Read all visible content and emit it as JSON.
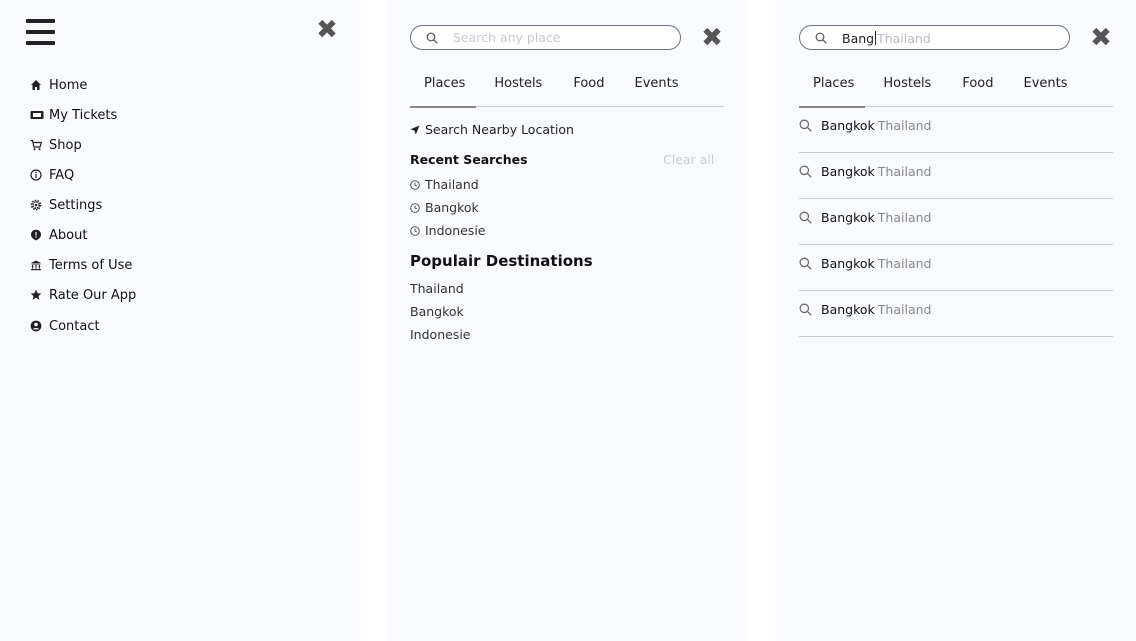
{
  "menu": {
    "items": [
      {
        "label": "Home",
        "icon": "home-icon"
      },
      {
        "label": "My Tickets",
        "icon": "ticket-icon"
      },
      {
        "label": "Shop",
        "icon": "cart-icon"
      },
      {
        "label": "FAQ",
        "icon": "info-icon"
      },
      {
        "label": "Settings",
        "icon": "gear-icon"
      },
      {
        "label": "About",
        "icon": "about-icon"
      },
      {
        "label": "Terms of Use",
        "icon": "terms-icon"
      },
      {
        "label": "Rate Our App",
        "icon": "star-icon"
      },
      {
        "label": "Contact",
        "icon": "user-icon"
      }
    ]
  },
  "search_panel": {
    "placeholder": "Search any place",
    "tabs": [
      "Places",
      "Hostels",
      "Food",
      "Events"
    ],
    "active_tab": "Places",
    "nearby_label": "Search Nearby Location",
    "recent_title": "Recent Searches",
    "clear_all": "Clear all",
    "recent": [
      "Thailand",
      "Bangkok",
      "Indonesie"
    ],
    "popular_title": "Populair Destinations",
    "popular": [
      "Thailand",
      "Bangkok",
      "Indonesie"
    ]
  },
  "results_panel": {
    "typed": "Bang",
    "suggestion": "Thailand",
    "tabs": [
      "Places",
      "Hostels",
      "Food",
      "Events"
    ],
    "active_tab": "Places",
    "results": [
      {
        "city": "Bangkok",
        "country": "Thailand"
      },
      {
        "city": "Bangkok",
        "country": "Thailand"
      },
      {
        "city": "Bangkok",
        "country": "Thailand"
      },
      {
        "city": "Bangkok",
        "country": "Thailand"
      },
      {
        "city": "Bangkok",
        "country": "Thailand"
      }
    ]
  },
  "colors": {
    "panel_bg": "#f8fafe",
    "border": "#c8ccd2",
    "muted_text": "#888888"
  }
}
